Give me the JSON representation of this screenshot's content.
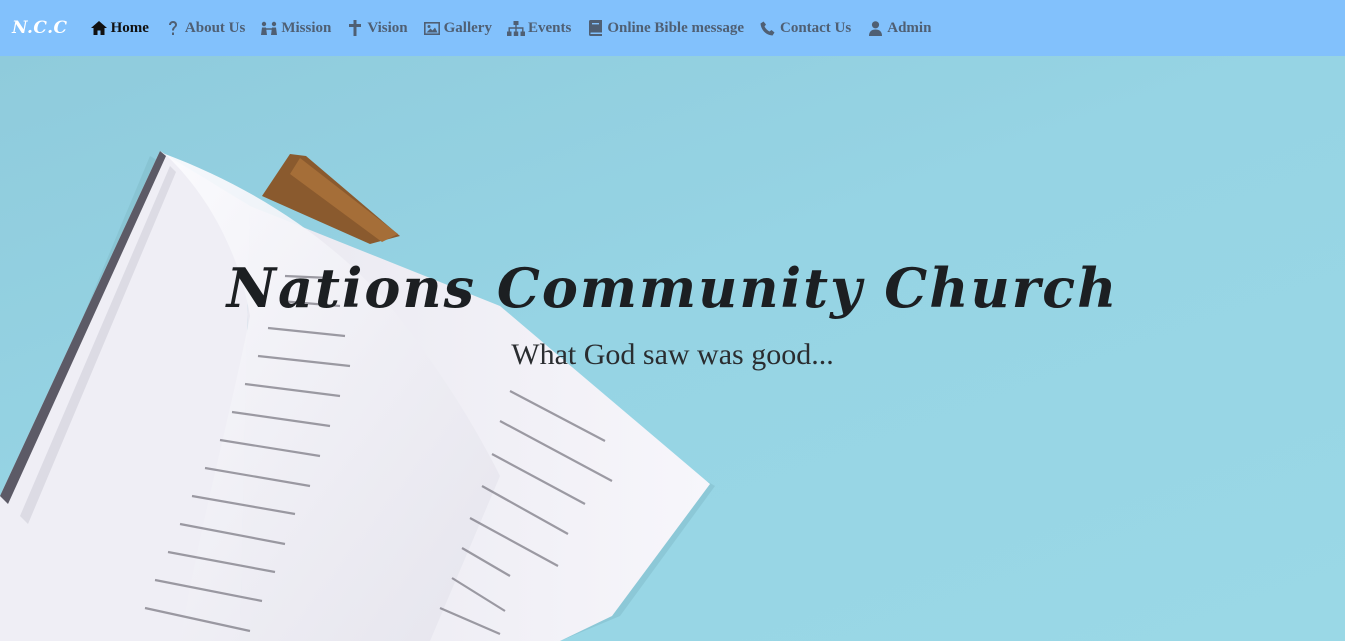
{
  "navbar": {
    "brand": "N.C.C",
    "items": [
      {
        "label": "Home",
        "icon": "home-icon",
        "active": true
      },
      {
        "label": "About Us",
        "icon": "question-icon",
        "active": false
      },
      {
        "label": "Mission",
        "icon": "people-icon",
        "active": false
      },
      {
        "label": "Vision",
        "icon": "cross-icon",
        "active": false
      },
      {
        "label": "Gallery",
        "icon": "image-icon",
        "active": false
      },
      {
        "label": "Events",
        "icon": "sitemap-icon",
        "active": false
      },
      {
        "label": "Online Bible message",
        "icon": "book-icon",
        "active": false
      },
      {
        "label": "Contact Us",
        "icon": "phone-icon",
        "active": false
      },
      {
        "label": "Admin",
        "icon": "user-icon",
        "active": false
      }
    ]
  },
  "hero": {
    "title": "Nations Community Church",
    "subtitle": "What God saw was good...",
    "background_color": "#96d4e4"
  },
  "colors": {
    "navbar_bg": "#82c1fc",
    "nav_text": "#4f5f73",
    "nav_active": "#111111"
  }
}
